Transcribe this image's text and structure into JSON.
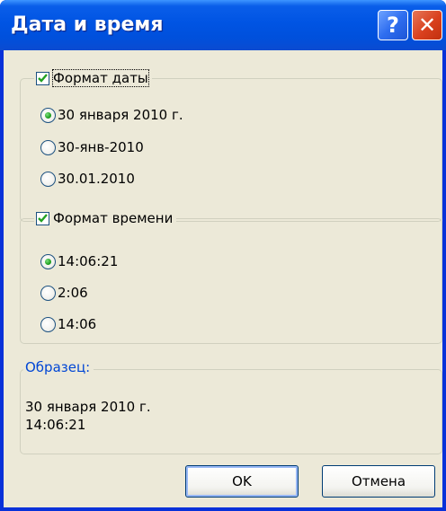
{
  "window": {
    "title": "Дата и время",
    "help_glyph": "?",
    "close_glyph": "✕"
  },
  "date_format": {
    "label": "Формат даты",
    "checked": true,
    "options": [
      "30 января 2010 г.",
      "30-янв-2010",
      "30.01.2010"
    ],
    "selected_index": 0
  },
  "time_format": {
    "label": "Формат времени",
    "checked": true,
    "options": [
      "14:06:21",
      "2:06",
      "14:06"
    ],
    "selected_index": 0
  },
  "sample": {
    "label": "Образец:",
    "date": "30 января 2010 г.",
    "time": "14:06:21"
  },
  "buttons": {
    "ok": "OK",
    "cancel": "Отмена"
  },
  "colors": {
    "titlebar": "#0054e3",
    "sample_label": "#0046d5",
    "radio_selected": "#21a121",
    "checkbox_mark": "#21a121"
  }
}
